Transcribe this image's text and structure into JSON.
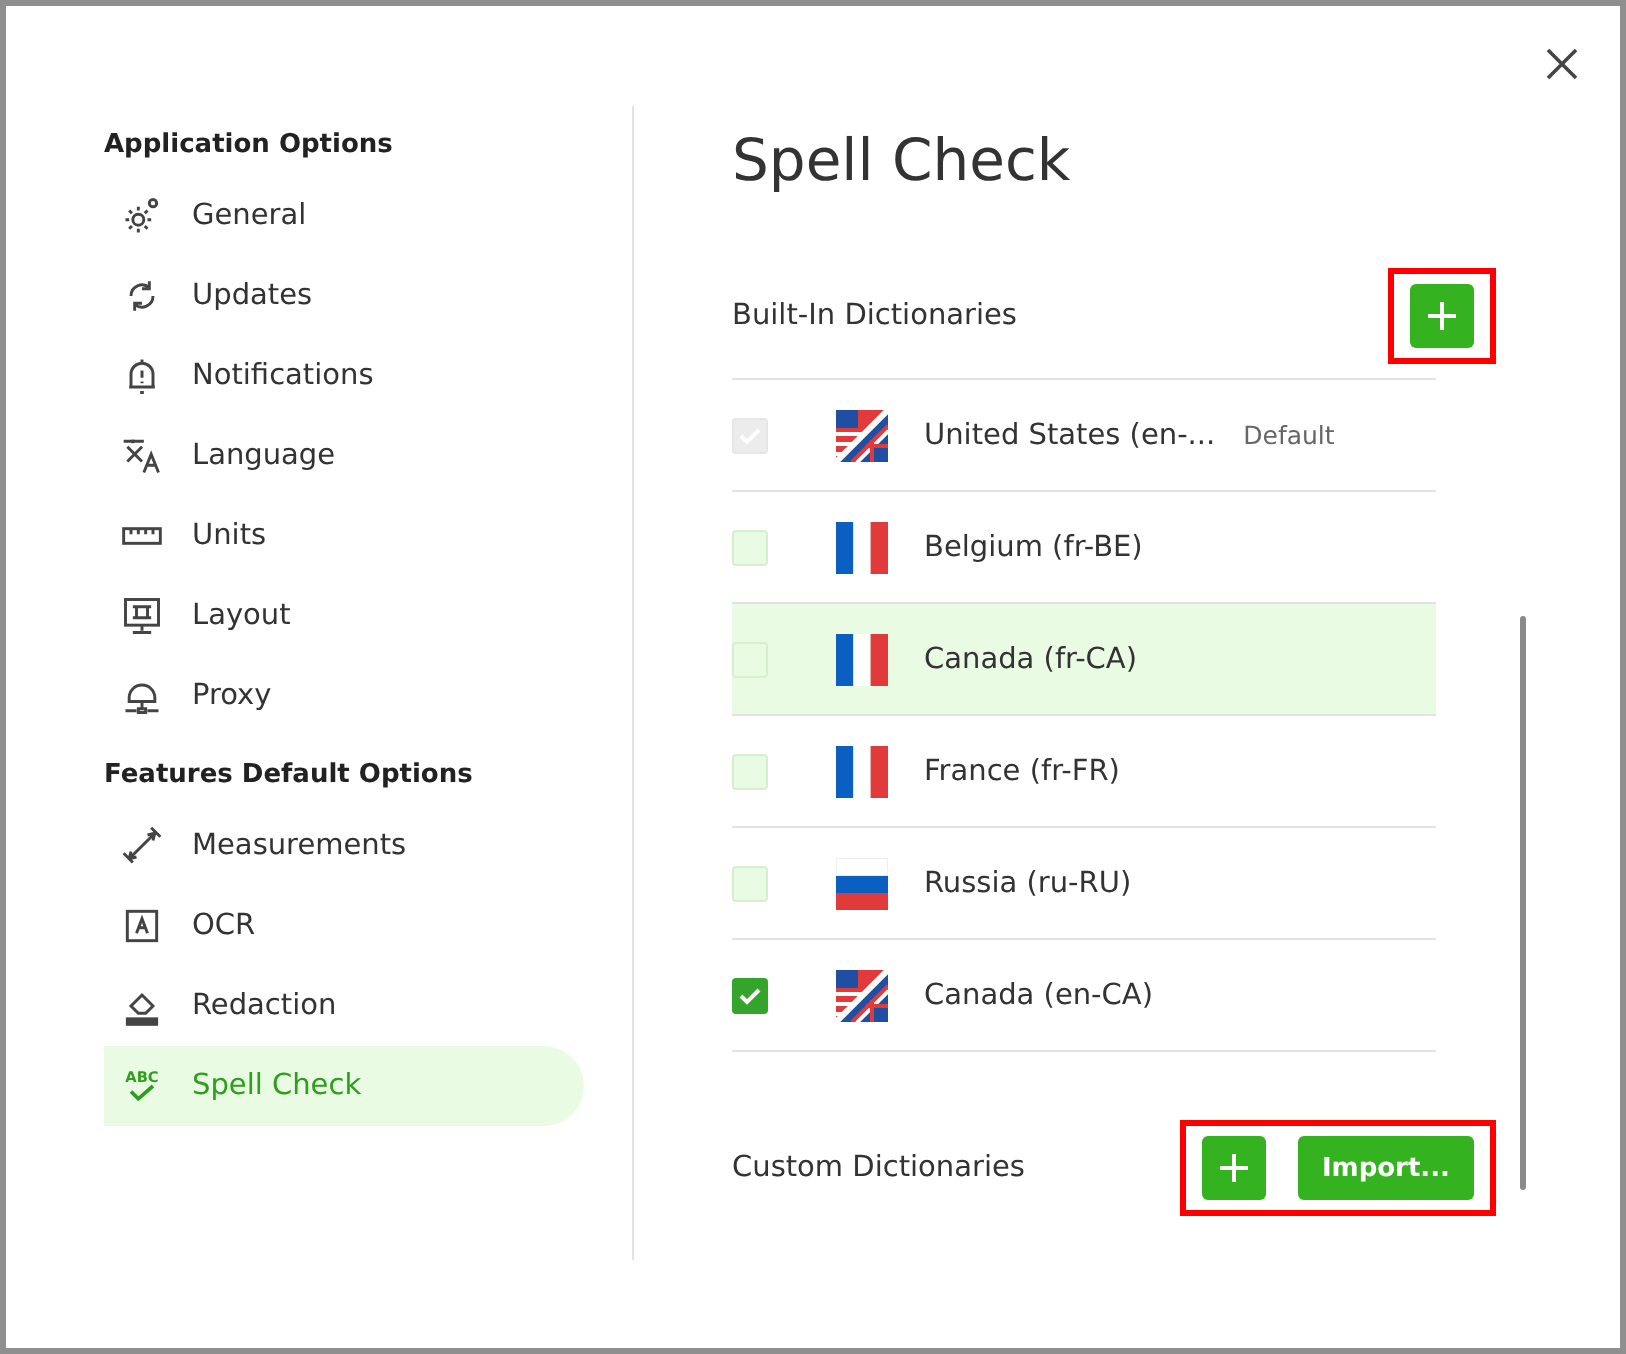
{
  "sidebar": {
    "sections": [
      {
        "title": "Application Options",
        "items": [
          {
            "kind": "gear",
            "label": "General",
            "selected": false
          },
          {
            "kind": "sync",
            "label": "Updates",
            "selected": false
          },
          {
            "kind": "bell",
            "label": "Notifications",
            "selected": false
          },
          {
            "kind": "translate",
            "label": "Language",
            "selected": false
          },
          {
            "kind": "ruler",
            "label": "Units",
            "selected": false
          },
          {
            "kind": "layout",
            "label": "Layout",
            "selected": false
          },
          {
            "kind": "proxy",
            "label": "Proxy",
            "selected": false
          }
        ]
      },
      {
        "title": "Features Default Options",
        "items": [
          {
            "kind": "measure",
            "label": "Measurements",
            "selected": false
          },
          {
            "kind": "ocr",
            "label": "OCR",
            "selected": false
          },
          {
            "kind": "eraser",
            "label": "Redaction",
            "selected": false
          },
          {
            "kind": "spell",
            "icon_text": "ABC",
            "label": "Spell Check",
            "selected": true
          }
        ]
      }
    ]
  },
  "content": {
    "title": "Spell Check",
    "built_in": {
      "heading": "Built-In Dictionaries",
      "add_highlighted": true,
      "rows": [
        {
          "kind": "us-uk",
          "name": "United States (en-...",
          "badge": "Default",
          "checked": true,
          "disabled": true,
          "hovered": false
        },
        {
          "kind": "fr",
          "name": "Belgium (fr-BE)",
          "checked": false,
          "disabled": false,
          "hovered": false
        },
        {
          "kind": "fr",
          "name": "Canada (fr-CA)",
          "checked": false,
          "disabled": false,
          "hovered": true
        },
        {
          "kind": "fr",
          "name": "France (fr-FR)",
          "checked": false,
          "disabled": false,
          "hovered": false
        },
        {
          "kind": "ru",
          "name": "Russia (ru-RU)",
          "checked": false,
          "disabled": false,
          "hovered": false
        },
        {
          "kind": "us-uk",
          "name": "Canada (en-CA)",
          "checked": true,
          "disabled": false,
          "hovered": false
        }
      ]
    },
    "custom": {
      "heading": "Custom Dictionaries",
      "import_label": "Import...",
      "buttons_highlighted": true
    }
  }
}
